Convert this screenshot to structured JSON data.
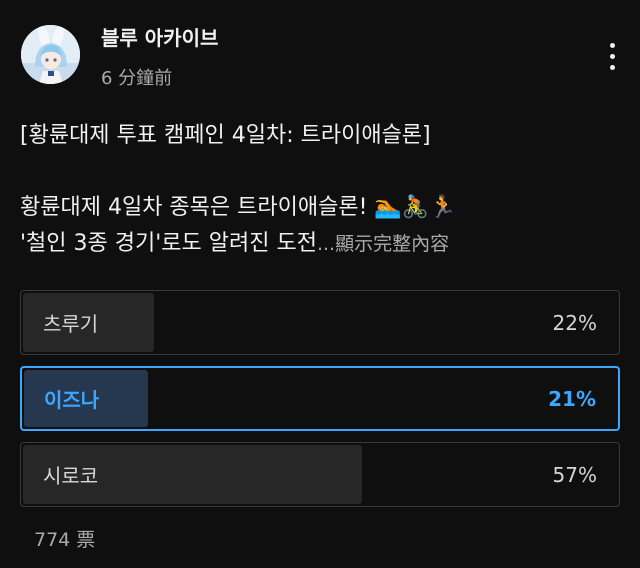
{
  "post": {
    "channel_name": "블루 아카이브",
    "timestamp": "6 分鐘前",
    "title_line": "[황륜대제 투표 캠페인 4일차: 트라이애슬론]",
    "body_line1": "황륜대제 4일차 종목은 트라이애슬론! ",
    "body_line1_emoji": "🏊🚴🏃",
    "body_line2": "'철인 3종 경기'로도 알려진 도전",
    "show_more": "...顯示完整內容",
    "more_icon": "vertical-ellipsis-icon"
  },
  "poll": {
    "options": [
      {
        "label": "츠루기",
        "percent_text": "22%",
        "percent": 22,
        "selected": false
      },
      {
        "label": "이즈나",
        "percent_text": "21%",
        "percent": 21,
        "selected": true
      },
      {
        "label": "시로코",
        "percent_text": "57%",
        "percent": 57,
        "selected": false
      }
    ],
    "vote_count": "774 票"
  },
  "colors": {
    "background": "#0f0f0f",
    "accent": "#3ea6ff",
    "bar": "#272727",
    "selected_bar": "#263850",
    "muted_text": "#aaaaaa"
  }
}
